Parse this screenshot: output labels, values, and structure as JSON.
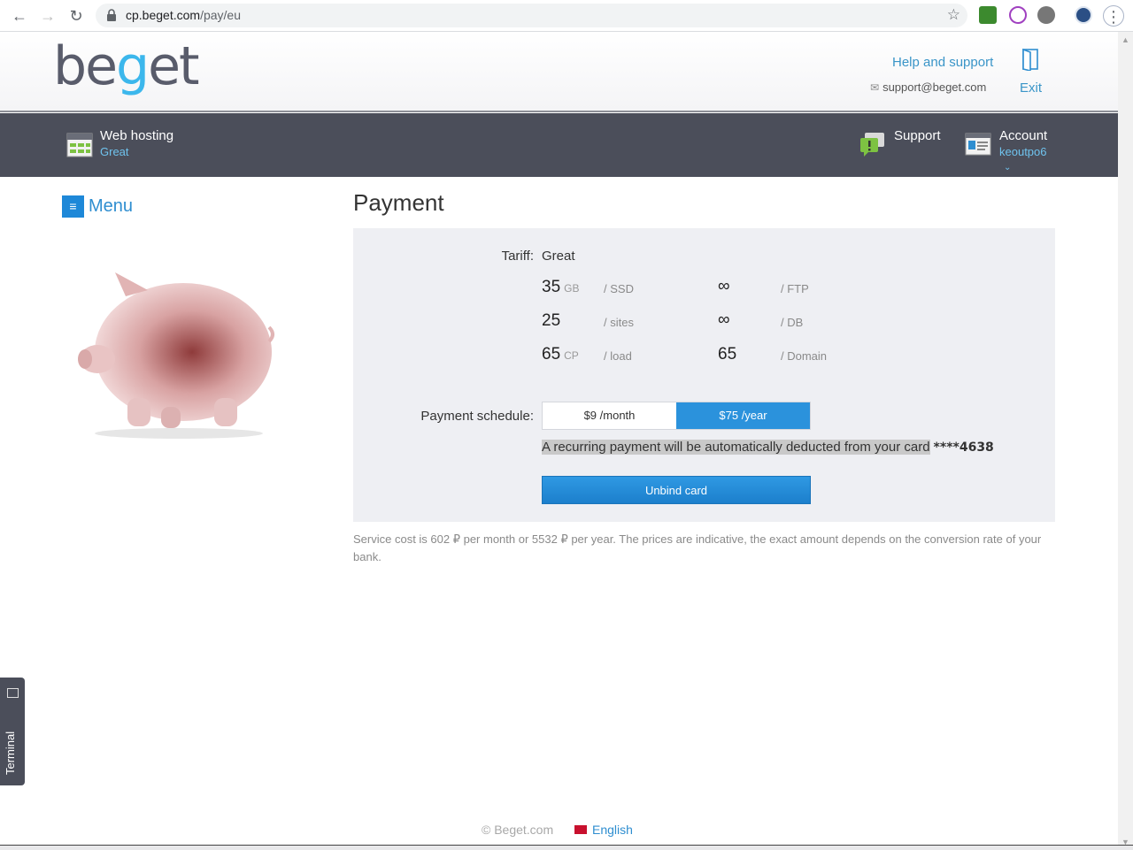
{
  "browser": {
    "url_host": "cp.beget.com",
    "url_path": "/pay/eu"
  },
  "header": {
    "logo_text_a": "be",
    "logo_text_g": "g",
    "logo_text_b": "et",
    "help_link": "Help and support",
    "support_email": "support@beget.com",
    "exit_label": "Exit"
  },
  "bar": {
    "hosting_title": "Web hosting",
    "hosting_plan": "Great",
    "support_label": "Support",
    "account_title": "Account",
    "account_user": "keoutpo6"
  },
  "sidebar": {
    "menu_icon": "≡",
    "menu_label": "Menu"
  },
  "payment": {
    "title": "Payment",
    "tariff_label": "Tariff:",
    "tariff_value": "Great",
    "specs": {
      "ssd_value": "35",
      "ssd_unit": "GB",
      "ssd_label": "/ SSD",
      "sites_value": "25",
      "sites_label": "/ sites",
      "cp_value": "65",
      "cp_unit": "CP",
      "cp_label": "/ load",
      "ftp_value": "∞",
      "ftp_label": "/ FTP",
      "db_value": "∞",
      "db_label": "/ DB",
      "domain_value": "65",
      "domain_label": "/ Domain"
    },
    "schedule_label": "Payment schedule:",
    "schedule_month": "$9 /month",
    "schedule_year": "$75 /year",
    "recurring_text": "A recurring payment will be automatically deducted from your card",
    "card_number": "****4638",
    "unbind_label": "Unbind card",
    "note": "Service cost is 602 ₽ per month or 5532 ₽ per year. The prices are indicative, the exact amount depends on the conversion rate of your bank."
  },
  "terminal": {
    "label": "Terminal"
  },
  "footer": {
    "copyright": "© Beget.com",
    "language": "English"
  }
}
